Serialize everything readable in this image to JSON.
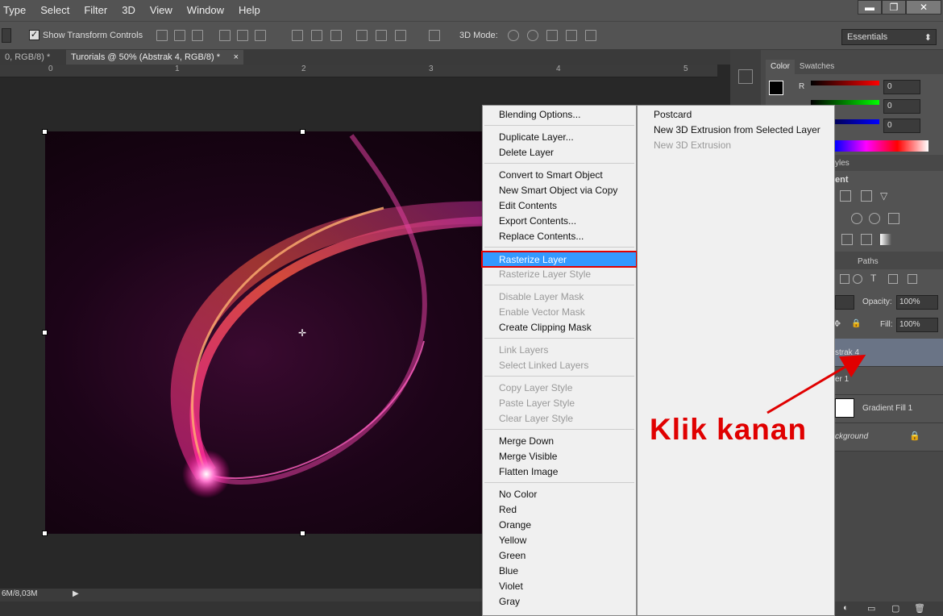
{
  "menubar": {
    "items": [
      "Type",
      "Select",
      "Filter",
      "3D",
      "View",
      "Window",
      "Help"
    ]
  },
  "window_controls": {
    "minimize": "▬",
    "restore": "❐",
    "close": "✕"
  },
  "options_bar": {
    "show_transform_controls": "Show Transform Controls",
    "mode_3d_label": "3D Mode:",
    "workspace": "Essentials"
  },
  "document_tabs": {
    "tab1": "0, RGB/8) *",
    "tab2": "Turorials @ 50% (Abstrak 4, RGB/8) *"
  },
  "ruler": {
    "ticks": [
      "0",
      "1",
      "2",
      "3",
      "4",
      "5"
    ]
  },
  "status_bar": {
    "doc_size": "6M/8,03M"
  },
  "right_panel": {
    "color_tab": "Color",
    "swatches_tab": "Swatches",
    "r_label": "R",
    "r_value": "0",
    "g_value": "0",
    "b_value": "0",
    "styles_tab": "yles",
    "adjust_heading": "ent",
    "paths_tab": "Paths",
    "opacity_label": "Opacity:",
    "opacity_value": "100%",
    "fill_label": "Fill:",
    "fill_value": "100%",
    "layers": [
      {
        "name": "strak 4"
      },
      {
        "name": "er 1"
      },
      {
        "name": "Gradient Fill 1"
      },
      {
        "name": "ckground"
      }
    ]
  },
  "context_menu": {
    "items": [
      {
        "label": "Blending Options...",
        "enabled": true
      },
      {
        "label": "Duplicate Layer...",
        "enabled": true
      },
      {
        "label": "Delete Layer",
        "enabled": true
      },
      {
        "label": "Convert to Smart Object",
        "enabled": true
      },
      {
        "label": "New Smart Object via Copy",
        "enabled": true
      },
      {
        "label": "Edit Contents",
        "enabled": true
      },
      {
        "label": "Export Contents...",
        "enabled": true
      },
      {
        "label": "Replace Contents...",
        "enabled": true
      },
      {
        "label": "Rasterize Layer",
        "enabled": true,
        "highlighted": true
      },
      {
        "label": "Rasterize Layer Style",
        "enabled": false
      },
      {
        "label": "Disable Layer Mask",
        "enabled": false
      },
      {
        "label": "Enable Vector Mask",
        "enabled": false
      },
      {
        "label": "Create Clipping Mask",
        "enabled": true
      },
      {
        "label": "Link Layers",
        "enabled": false
      },
      {
        "label": "Select Linked Layers",
        "enabled": false
      },
      {
        "label": "Copy Layer Style",
        "enabled": false
      },
      {
        "label": "Paste Layer Style",
        "enabled": false
      },
      {
        "label": "Clear Layer Style",
        "enabled": false
      },
      {
        "label": "Merge Down",
        "enabled": true
      },
      {
        "label": "Merge Visible",
        "enabled": true
      },
      {
        "label": "Flatten Image",
        "enabled": true
      },
      {
        "label": "No Color",
        "enabled": true
      },
      {
        "label": "Red",
        "enabled": true
      },
      {
        "label": "Orange",
        "enabled": true
      },
      {
        "label": "Yellow",
        "enabled": true
      },
      {
        "label": "Green",
        "enabled": true
      },
      {
        "label": "Blue",
        "enabled": true
      },
      {
        "label": "Violet",
        "enabled": true
      },
      {
        "label": "Gray",
        "enabled": true
      }
    ]
  },
  "submenu": {
    "items": [
      {
        "label": "Postcard",
        "enabled": true
      },
      {
        "label": "New 3D Extrusion from Selected Layer",
        "enabled": true
      },
      {
        "label": "New 3D Extrusion",
        "enabled": false
      }
    ]
  },
  "annotation": {
    "text": "Klik kanan",
    "color": "#e00000"
  },
  "colors": {
    "highlight": "#3399ff",
    "annotation": "#e00000",
    "panel": "#484848"
  }
}
